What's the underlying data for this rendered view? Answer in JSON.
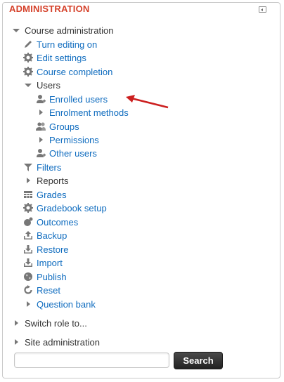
{
  "block": {
    "title": "ADMINISTRATION",
    "collapse_icon": "collapse-block-icon"
  },
  "course_admin": {
    "label": "Course administration",
    "items": [
      {
        "label": "Turn editing on",
        "icon": "pencil-icon"
      },
      {
        "label": "Edit settings",
        "icon": "gear-icon"
      },
      {
        "label": "Course completion",
        "icon": "gear-icon"
      }
    ],
    "users": {
      "label": "Users",
      "items": [
        {
          "label": "Enrolled users",
          "icon": "user-icon"
        },
        {
          "label": "Enrolment methods",
          "icon": "expand-icon"
        },
        {
          "label": "Groups",
          "icon": "users-icon"
        },
        {
          "label": "Permissions",
          "icon": "expand-icon"
        },
        {
          "label": "Other users",
          "icon": "user-icon"
        }
      ]
    },
    "more_items": [
      {
        "label": "Filters",
        "icon": "filter-icon"
      },
      {
        "label": "Reports",
        "icon": "expand-icon"
      },
      {
        "label": "Grades",
        "icon": "table-icon"
      },
      {
        "label": "Gradebook setup",
        "icon": "gear-icon"
      },
      {
        "label": "Outcomes",
        "icon": "outcomes-icon"
      },
      {
        "label": "Backup",
        "icon": "upload-icon"
      },
      {
        "label": "Restore",
        "icon": "download-icon"
      },
      {
        "label": "Import",
        "icon": "download-icon"
      },
      {
        "label": "Publish",
        "icon": "globe-icon"
      },
      {
        "label": "Reset",
        "icon": "reset-icon"
      },
      {
        "label": "Question bank",
        "icon": "expand-icon"
      }
    ]
  },
  "switch_role": {
    "label": "Switch role to..."
  },
  "site_admin": {
    "label": "Site administration"
  },
  "search": {
    "placeholder": "",
    "button_label": "Search"
  },
  "colors": {
    "title": "#d5412a",
    "link": "#0f6cbf",
    "text": "#333333",
    "arrow": "#cc1f1f"
  }
}
